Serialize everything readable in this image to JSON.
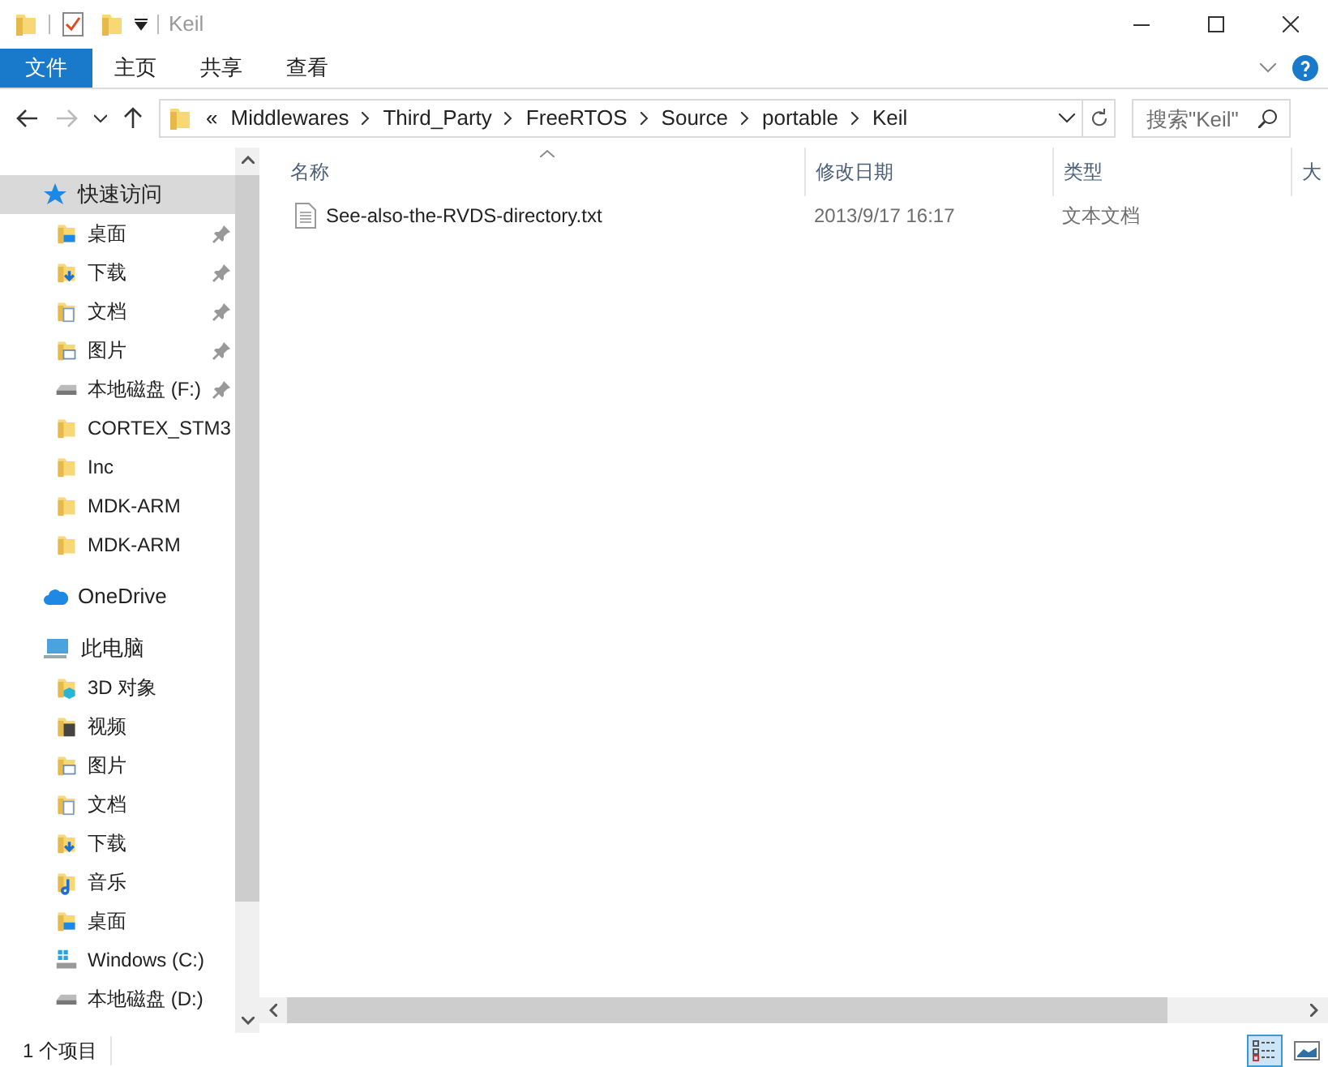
{
  "window": {
    "title": "Keil"
  },
  "ribbon_tabs": [
    {
      "label": "文件",
      "selected": true
    },
    {
      "label": "主页",
      "selected": false
    },
    {
      "label": "共享",
      "selected": false
    },
    {
      "label": "查看",
      "selected": false
    }
  ],
  "address_bar": {
    "overflow": "«",
    "crumbs": [
      "Middlewares",
      "Third_Party",
      "FreeRTOS",
      "Source",
      "portable",
      "Keil"
    ]
  },
  "search": {
    "placeholder": "搜索\"Keil\""
  },
  "sidebar": {
    "items": [
      {
        "label": "快速访问",
        "kind": "star",
        "selected": true,
        "children": [
          {
            "label": "桌面",
            "kind": "desktop",
            "pinned": true
          },
          {
            "label": "下载",
            "kind": "download",
            "pinned": true
          },
          {
            "label": "文档",
            "kind": "document",
            "pinned": true
          },
          {
            "label": "图片",
            "kind": "picture",
            "pinned": true
          },
          {
            "label": "本地磁盘 (F:)",
            "kind": "drive",
            "pinned": true
          },
          {
            "label": "CORTEX_STM3",
            "kind": "folder",
            "pinned": false
          },
          {
            "label": "Inc",
            "kind": "folder",
            "pinned": false
          },
          {
            "label": "MDK-ARM",
            "kind": "folder",
            "pinned": false
          },
          {
            "label": "MDK-ARM",
            "kind": "folder",
            "pinned": false
          }
        ]
      },
      {
        "label": "OneDrive",
        "kind": "cloud",
        "selected": false
      },
      {
        "label": "此电脑",
        "kind": "pc",
        "selected": false,
        "children": [
          {
            "label": "3D 对象",
            "kind": "cube",
            "pinned": false
          },
          {
            "label": "视频",
            "kind": "video",
            "pinned": false
          },
          {
            "label": "图片",
            "kind": "picture",
            "pinned": false
          },
          {
            "label": "文档",
            "kind": "document",
            "pinned": false
          },
          {
            "label": "下载",
            "kind": "download",
            "pinned": false
          },
          {
            "label": "音乐",
            "kind": "music",
            "pinned": false
          },
          {
            "label": "桌面",
            "kind": "desktop",
            "pinned": false
          },
          {
            "label": "Windows (C:)",
            "kind": "windows",
            "pinned": false
          },
          {
            "label": "本地磁盘 (D:)",
            "kind": "drive",
            "pinned": false
          }
        ]
      }
    ]
  },
  "table": {
    "columns": [
      "名称",
      "修改日期",
      "类型",
      "大"
    ],
    "rows": [
      {
        "name": "See-also-the-RVDS-directory.txt",
        "modified": "2013/9/17 16:17",
        "type": "文本文档"
      }
    ]
  },
  "status_bar": {
    "text": "1 个项目",
    "views": [
      {
        "kind": "details",
        "selected": true
      },
      {
        "kind": "thumbnails",
        "selected": false
      }
    ]
  }
}
